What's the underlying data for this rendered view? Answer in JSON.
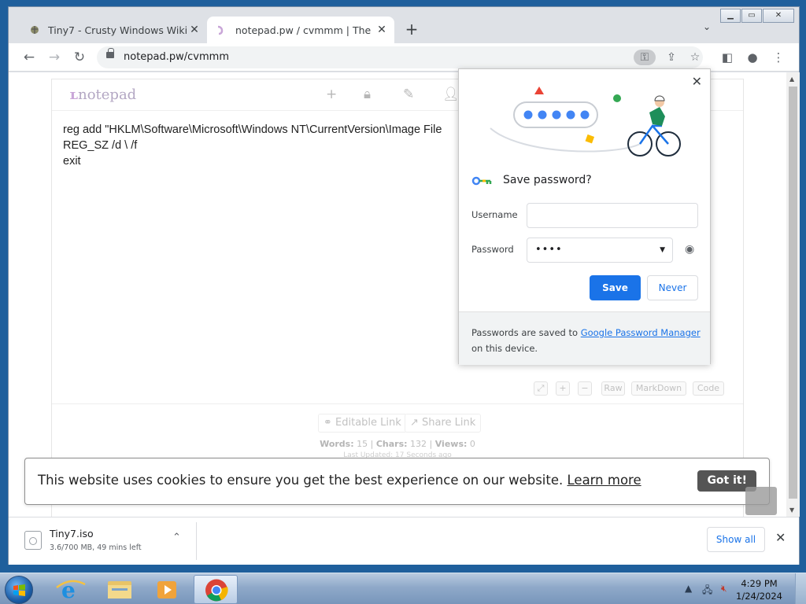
{
  "browser": {
    "tabs": [
      {
        "title": "Tiny7 - Crusty Windows Wiki",
        "active": false
      },
      {
        "title": "notepad.pw / cvmmm | The napkin",
        "active": true
      }
    ],
    "url": "notepad.pw/cvmmm"
  },
  "notepad": {
    "logo": "notepad",
    "editor_lines": [
      "reg add \"HKLM\\Software\\Microsoft\\Windows NT\\CurrentVersion\\Image File",
      "REG_SZ /d \\ /f",
      "exit"
    ],
    "tools": [
      "⤢",
      "+",
      "−",
      "Raw",
      "MarkDown",
      "Code"
    ],
    "editable_link": "Editable Link",
    "share_link": "Share Link",
    "stats": {
      "words_label": "Words:",
      "words": "15",
      "chars_label": "Chars:",
      "chars": "132",
      "views_label": "Views:",
      "views": "0"
    },
    "last_updated": "Last Updated: 17 Seconds ago"
  },
  "cookie_banner": {
    "message": "This website uses cookies to ensure you get the best experience on our website.",
    "learn_more": "Learn more",
    "button": "Got it!"
  },
  "password_bubble": {
    "title": "Save password?",
    "username_label": "Username",
    "username_value": "",
    "password_label": "Password",
    "password_value": "••••",
    "save": "Save",
    "never": "Never",
    "footer_prefix": "Passwords are saved to",
    "footer_link": "Google Password Manager",
    "footer_suffix": "on this device."
  },
  "downloads": {
    "file_name": "Tiny7.iso",
    "status": "3.6/700 MB, 49 mins left",
    "show_all": "Show all"
  },
  "taskbar": {
    "time": "4:29 PM",
    "date": "1/24/2024"
  },
  "colors": {
    "accent_blue": "#1a73e8",
    "notepad_purple": "#c9a6d8",
    "cookie_button": "#555555"
  }
}
